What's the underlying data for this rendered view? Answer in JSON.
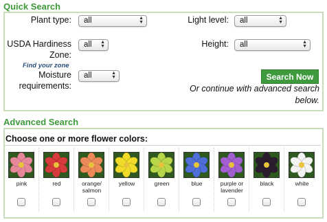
{
  "quick_search": {
    "title": "Quick Search",
    "plant_type": {
      "label": "Plant type:",
      "value": "all"
    },
    "light_level": {
      "label": "Light level:",
      "value": "all"
    },
    "hardiness": {
      "label_line1": "USDA Hardiness",
      "label_line2": "Zone:",
      "value": "all",
      "find_zone": "Find your zone"
    },
    "height": {
      "label": "Height:",
      "value": "all"
    },
    "moisture": {
      "label_line1": "Moisture",
      "label_line2": "requirements:",
      "value": "all"
    },
    "search_button": "Search Now",
    "note_line1": "Or continue with advanced search",
    "note_line2": "below."
  },
  "advanced_search": {
    "title": "Advanced Search",
    "colors_heading": "Choose one or more flower colors:",
    "colors": [
      {
        "line1": "pink",
        "line2": "",
        "hex": "#e7879a",
        "icon": "pink-flower-icon"
      },
      {
        "line1": "red",
        "line2": "",
        "hex": "#d63a3a",
        "icon": "red-flower-icon"
      },
      {
        "line1": "orange/",
        "line2": "salmon",
        "hex": "#ec8a5a",
        "icon": "orange-flower-icon"
      },
      {
        "line1": "yellow",
        "line2": "",
        "hex": "#f2dc2a",
        "icon": "yellow-flower-icon"
      },
      {
        "line1": "green",
        "line2": "",
        "hex": "#b7d64a",
        "icon": "green-flower-icon"
      },
      {
        "line1": "blue",
        "line2": "",
        "hex": "#4f6ed8",
        "icon": "blue-flower-icon"
      },
      {
        "line1": "purple or",
        "line2": "lavender",
        "hex": "#a35fd1",
        "icon": "purple-flower-icon"
      },
      {
        "line1": "black",
        "line2": "",
        "hex": "#2a1c2e",
        "icon": "black-flower-icon"
      },
      {
        "line1": "white",
        "line2": "",
        "hex": "#f3f3f3",
        "icon": "white-flower-icon"
      }
    ]
  },
  "colors": {
    "accent_green": "#3d9a3a",
    "panel_border": "#c8ddb9",
    "link_blue": "#2a4f7a"
  }
}
